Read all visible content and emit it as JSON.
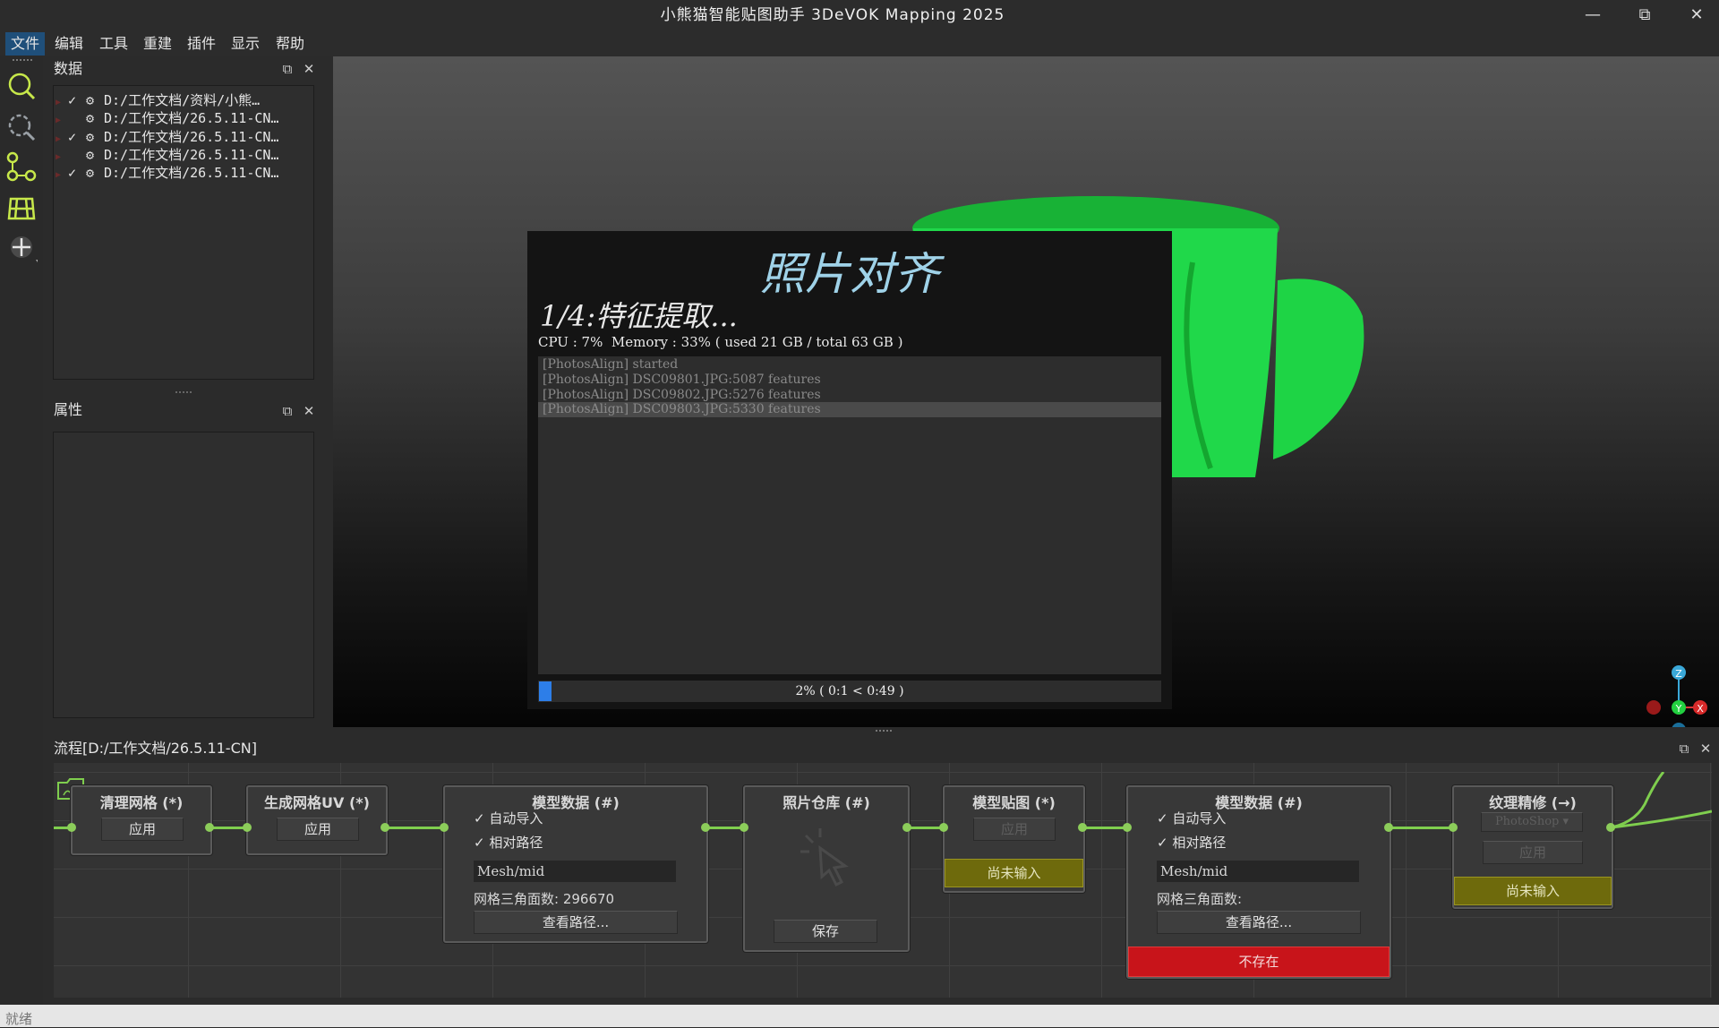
{
  "window": {
    "title": "小熊猫智能贴图助手 3DeVOK Mapping 2025",
    "minimize": "—",
    "restore": "⧉",
    "close": "✕"
  },
  "menu": [
    {
      "label": "文件",
      "active": true
    },
    {
      "label": "编辑"
    },
    {
      "label": "工具"
    },
    {
      "label": "重建"
    },
    {
      "label": "插件"
    },
    {
      "label": "显示"
    },
    {
      "label": "帮助"
    }
  ],
  "toolbar": [
    "search-icon",
    "zoom-fit-icon",
    "node-graph-icon",
    "grid-mesh-icon",
    "move-icon"
  ],
  "data_panel": {
    "title": "数据",
    "items": [
      {
        "checked": true,
        "label": "D:/工作文档/资料/小熊…"
      },
      {
        "checked": false,
        "label": "D:/工作文档/26.5.11-CN…"
      },
      {
        "checked": true,
        "label": "D:/工作文档/26.5.11-CN…"
      },
      {
        "checked": false,
        "label": "D:/工作文档/26.5.11-CN…"
      },
      {
        "checked": true,
        "label": "D:/工作文档/26.5.11-CN…"
      }
    ],
    "check_glyph": "✓",
    "gear_glyph": "⚙",
    "arrow_glyph": "▶"
  },
  "props_panel": {
    "title": "属性"
  },
  "panel_float_glyph": "⧉",
  "panel_close_glyph": "✕",
  "dialog": {
    "title": "照片对齐",
    "stage": "1/4:特征提取...",
    "stats": "CPU : 7%  Memory : 33% ( used 21 GB / total 63 GB )",
    "log": [
      "[PhotosAlign] started",
      "[PhotosAlign] DSC09801.JPG:5087 features",
      "[PhotosAlign] DSC09802.JPG:5276 features",
      "[PhotosAlign] DSC09803.JPG:5330 features"
    ],
    "progress_fraction": 0.02,
    "progress_text": "2% ( 0:1 < 0:49 )"
  },
  "axes_gizmo": {
    "z": "Z",
    "y": "Y",
    "x": "X"
  },
  "process_panel": {
    "title": "流程[D:/工作文档/26.5.11-CN]",
    "nodes": {
      "clean": {
        "title": "清理网格 (*)",
        "button": "应用"
      },
      "uv": {
        "title": "生成网格UV (*)",
        "button": "应用"
      },
      "model1": {
        "title": "模型数据 (#)",
        "auto_import": "自动导入",
        "relative_path": "相对路径",
        "path": "Mesh/mid",
        "faces": "网格三角面数: 296670",
        "view": "查看路径..."
      },
      "photos": {
        "title": "照片仓库 (#)",
        "button": "保存"
      },
      "texture": {
        "title": "模型贴图 (*)",
        "button": "应用",
        "status": "尚未输入"
      },
      "model2": {
        "title": "模型数据 (#)",
        "auto_import": "自动导入",
        "relative_path": "相对路径",
        "path": "Mesh/mid",
        "faces": "网格三角面数:",
        "view": "查看路径...",
        "status": "不存在"
      },
      "retouch": {
        "title": "纹理精修 (→)",
        "select": "PhotoShop",
        "button": "应用",
        "status": "尚未输入"
      }
    }
  },
  "status_bar": {
    "text": "就绪"
  },
  "colors": {
    "accent": "#2d7ee8",
    "wire": "#7fce4e",
    "mesh": "#22e34a",
    "warning": "#6e6a0c",
    "error": "#c8141a"
  }
}
